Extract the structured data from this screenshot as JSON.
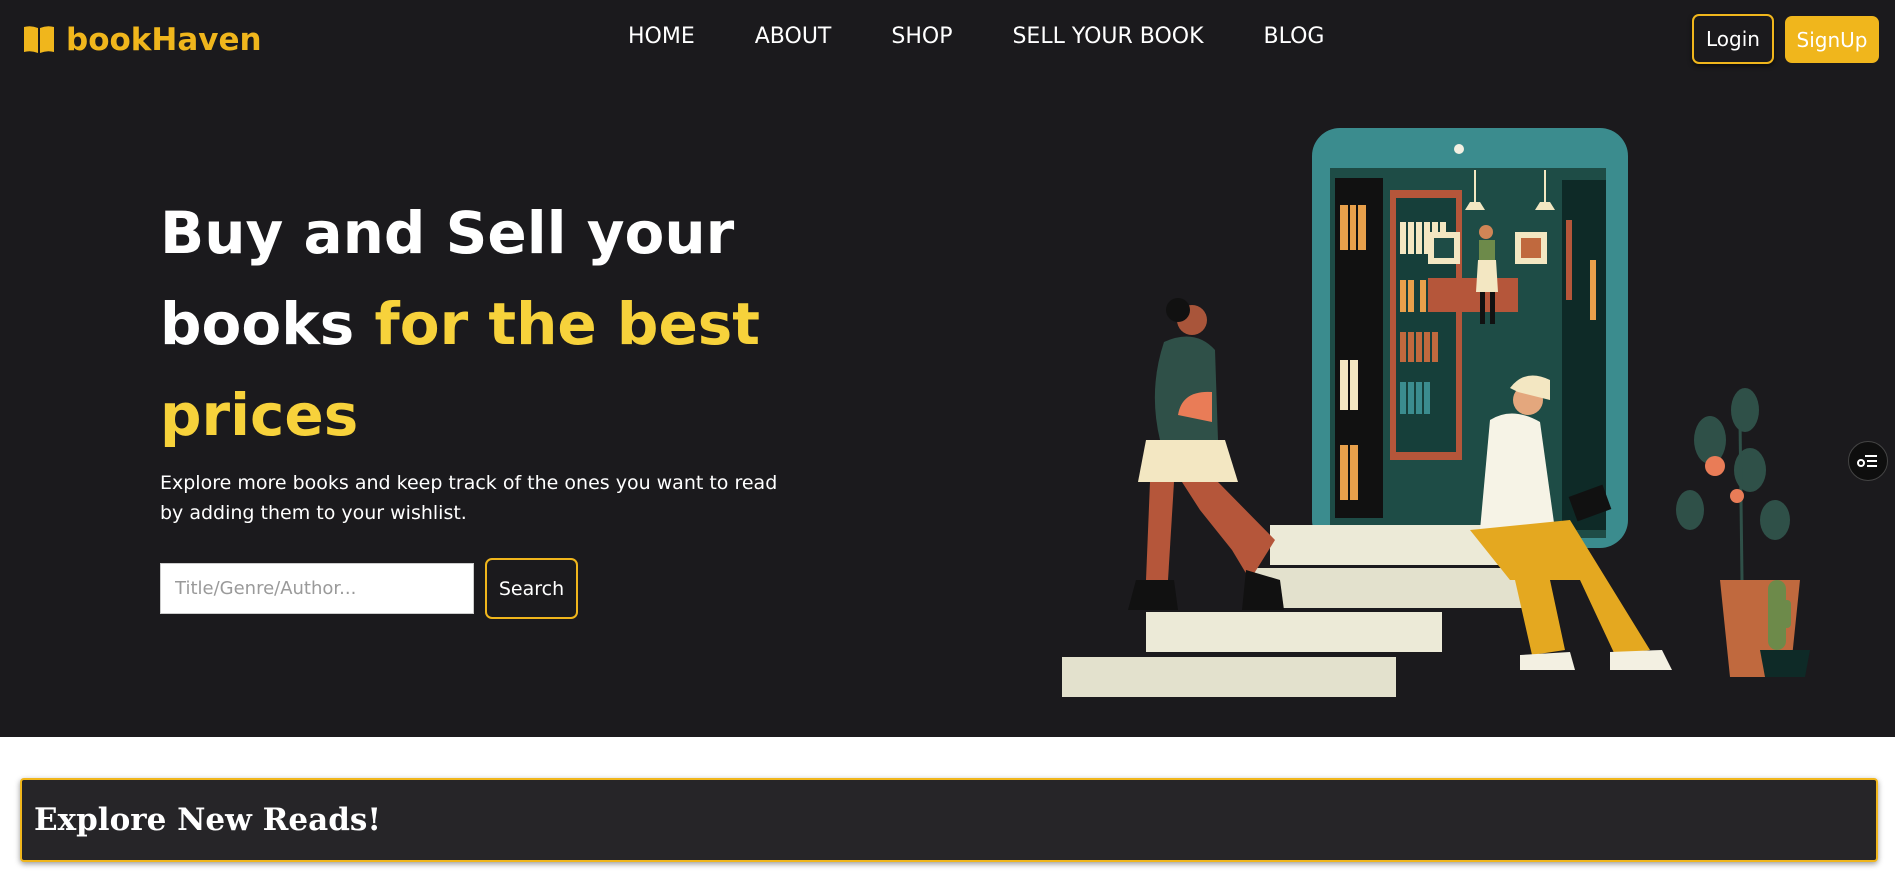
{
  "brand": {
    "name": "bookHaven"
  },
  "nav": {
    "items": [
      "HOME",
      "ABOUT",
      "SHOP",
      "SELL YOUR BOOK",
      "BLOG"
    ]
  },
  "auth": {
    "login": "Login",
    "signup": "SignUp"
  },
  "hero": {
    "headline_part1": "Buy and Sell your books ",
    "headline_highlight": "for the best prices",
    "subtitle": "Explore more books and keep track of the ones you want to read by adding them to your wishlist.",
    "search_placeholder": "Title/Genre/Author...",
    "search_button": "Search"
  },
  "explore": {
    "title": "Explore New Reads!"
  },
  "colors": {
    "accent": "#f0b61c",
    "highlight": "#f7d23b",
    "background": "#1b1a1d"
  },
  "icons": {
    "logo": "open-book-icon",
    "floating": "list-settings-icon"
  }
}
